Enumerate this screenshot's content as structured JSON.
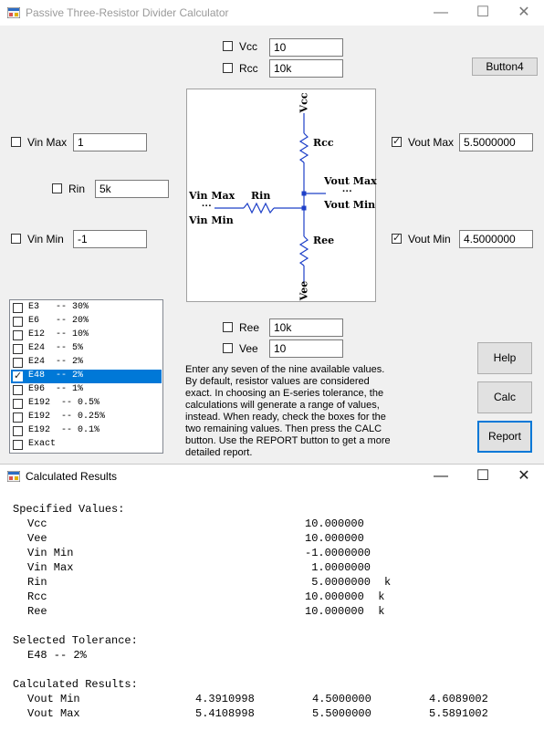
{
  "main_window": {
    "title": "Passive Three-Resistor Divider Calculator",
    "controls": {
      "minimize": "—",
      "maximize": "☐",
      "close": "✕"
    },
    "fields": {
      "vcc": {
        "label": "Vcc",
        "value": "10",
        "checked": false
      },
      "rcc": {
        "label": "Rcc",
        "value": "10k",
        "checked": false
      },
      "vin_max": {
        "label": "Vin Max",
        "value": "1",
        "checked": false
      },
      "rin": {
        "label": "Rin",
        "value": "5k",
        "checked": false
      },
      "vin_min": {
        "label": "Vin Min",
        "value": "-1",
        "checked": false
      },
      "vout_max": {
        "label": "Vout Max",
        "value": "5.5000000",
        "checked": true
      },
      "vout_min": {
        "label": "Vout Min",
        "value": "4.5000000",
        "checked": true
      },
      "ree": {
        "label": "Ree",
        "value": "10k",
        "checked": false
      },
      "vee": {
        "label": "Vee",
        "value": "10",
        "checked": false
      }
    },
    "button4": "Button4",
    "tolerance_list": [
      {
        "text": "E3   -- 30%",
        "checked": false,
        "selected": false
      },
      {
        "text": "E6   -- 20%",
        "checked": false,
        "selected": false
      },
      {
        "text": "E12  -- 10%",
        "checked": false,
        "selected": false
      },
      {
        "text": "E24  -- 5%",
        "checked": false,
        "selected": false
      },
      {
        "text": "E24  -- 2%",
        "checked": false,
        "selected": false
      },
      {
        "text": "E48  -- 2%",
        "checked": true,
        "selected": true
      },
      {
        "text": "E96  -- 1%",
        "checked": false,
        "selected": false
      },
      {
        "text": "E192  -- 0.5%",
        "checked": false,
        "selected": false
      },
      {
        "text": "E192  -- 0.25%",
        "checked": false,
        "selected": false
      },
      {
        "text": "E192  -- 0.1%",
        "checked": false,
        "selected": false
      },
      {
        "text": "Exact",
        "checked": false,
        "selected": false
      }
    ],
    "diagram_labels": {
      "vcc": "Vcc",
      "rcc": "Rcc",
      "vout_max": "Vout Max",
      "dots": "···",
      "vout_min": "Vout Min",
      "vin_max": "Vin Max",
      "rin": "Rin",
      "vin_min": "Vin Min",
      "ree": "Ree",
      "vee": "Vee"
    },
    "instructions": "Enter any seven of the nine available values. By default, resistor values are considered exact. In choosing an E-series tolerance, the calculations will generate a range of values, instead. When ready, check the boxes for the two remaining values. Then press the CALC button. Use the REPORT button to get a more detailed report.",
    "buttons": {
      "help": "Help",
      "calc": "Calc",
      "report": "Report"
    }
  },
  "results_window": {
    "title": "Calculated Results",
    "controls": {
      "minimize": "—",
      "maximize": "☐",
      "close": "✕"
    },
    "specified_header": "Specified Values:",
    "specified": [
      {
        "name": "Vcc",
        "value": "10.000000",
        "unit": ""
      },
      {
        "name": "Vee",
        "value": "10.000000",
        "unit": ""
      },
      {
        "name": "Vin Min",
        "value": "-1.0000000",
        "unit": ""
      },
      {
        "name": "Vin Max",
        "value": " 1.0000000",
        "unit": ""
      },
      {
        "name": "Rin",
        "value": " 5.0000000",
        "unit": "k"
      },
      {
        "name": "Rcc",
        "value": "10.000000",
        "unit": " k"
      },
      {
        "name": "Ree",
        "value": "10.000000",
        "unit": " k"
      }
    ],
    "tolerance_header": "Selected Tolerance:",
    "tolerance_value": "E48 -- 2%",
    "calculated_header": "Calculated Results:",
    "calculated": [
      {
        "name": "Vout Min",
        "min": "4.3910998",
        "nom": "4.5000000",
        "max": "4.6089002"
      },
      {
        "name": "Vout Max",
        "min": "5.4108998",
        "nom": "5.5000000",
        "max": "5.5891002"
      }
    ]
  }
}
